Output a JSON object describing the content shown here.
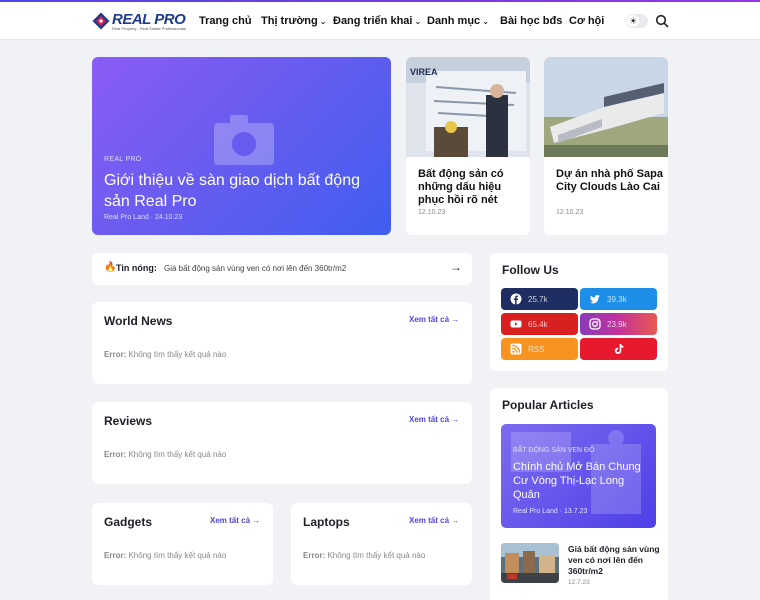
{
  "brand": {
    "name": "REAL PRO",
    "tagline": "Real Property - Real Estate Professionals"
  },
  "nav": [
    {
      "label": "Trang chủ",
      "dropdown": false
    },
    {
      "label": "Thị trường",
      "dropdown": true
    },
    {
      "label": "Đang triển khai",
      "dropdown": true
    },
    {
      "label": "Danh mục",
      "dropdown": true
    },
    {
      "label": "Bài học bđs",
      "dropdown": false
    },
    {
      "label": "Cơ hội",
      "dropdown": false
    }
  ],
  "hero": {
    "category": "REAL PRO",
    "title": "Giới thiệu về sàn giao dịch bất động sản Real Pro",
    "author": "Real Pro Land",
    "date": "24.10.23"
  },
  "cards": [
    {
      "title": "Bất động sản có những dấu hiệu phục hồi rõ nét",
      "date": "12.10.23",
      "banner": "VIREA"
    },
    {
      "title": "Dự án nhà phố Sapa City Clouds Lào Cai",
      "date": "12.10.23"
    }
  ],
  "hot": {
    "label": "Tin nóng:",
    "text": "Giá bất động sản vùng ven có nơi lên đến 360tr/m2"
  },
  "sections": [
    {
      "title": "World News",
      "more": "Xem tất cả",
      "error_label": "Error:",
      "error_text": "Không tìm thấy kết quả nào"
    },
    {
      "title": "Reviews",
      "more": "Xem tất cả",
      "error_label": "Error:",
      "error_text": "Không tìm thấy kết quả nào"
    },
    {
      "title": "Gadgets",
      "more": "Xem tất cả",
      "error_label": "Error:",
      "error_text": "Không tìm thấy kết quả nào"
    },
    {
      "title": "Laptops",
      "more": "Xem tất cả",
      "error_label": "Error:",
      "error_text": "Không tìm thấy kết quả nào"
    }
  ],
  "follow": {
    "title": "Follow Us",
    "items": [
      {
        "network": "facebook",
        "icon": "facebook-icon",
        "count": "25.7k",
        "color": "#1e2d62"
      },
      {
        "network": "twitter",
        "icon": "twitter-icon",
        "count": "39.3k",
        "color": "#1d8fe8"
      },
      {
        "network": "youtube",
        "icon": "youtube-icon",
        "count": "65.4k",
        "color": "#d92020"
      },
      {
        "network": "instagram",
        "icon": "instagram-icon",
        "count": "23.9k",
        "color": "#c2339b"
      },
      {
        "network": "rss",
        "icon": "rss-icon",
        "count": "RSS",
        "color": "#f7931e"
      },
      {
        "network": "tiktok",
        "icon": "tiktok-icon",
        "count": "",
        "color": "#e8192c"
      }
    ]
  },
  "popular": {
    "title": "Popular Articles",
    "featured": {
      "category": "BẤT ĐỘNG SẢN VEN ĐÔ",
      "title": "Chính chủ Mở Bán Chung Cư Vòng Thị-Lạc Long Quân",
      "author": "Real Pro Land",
      "date": "13.7.23"
    },
    "items": [
      {
        "title": "Giá bất động sản vùng ven có nơi lên đến 360tr/m2",
        "date": "12.7.23"
      }
    ]
  }
}
